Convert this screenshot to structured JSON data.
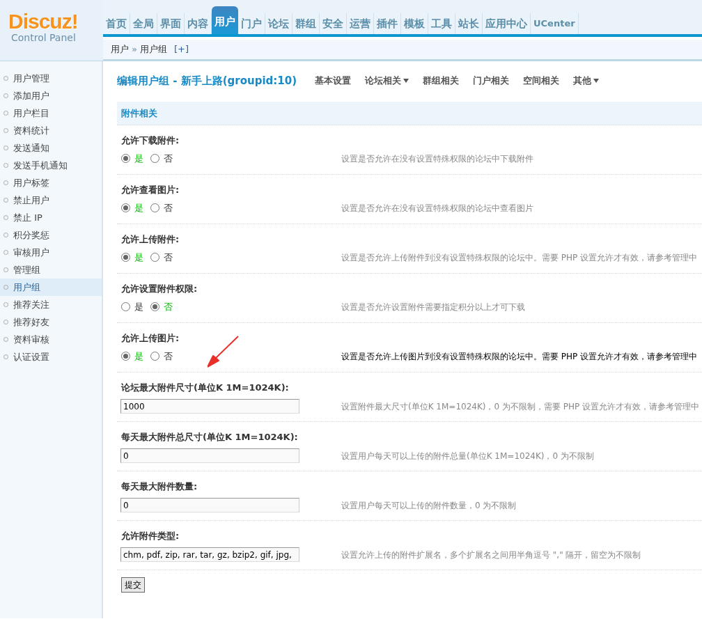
{
  "logo": {
    "title": "Discuz!",
    "subtitle": "Control Panel"
  },
  "nav": [
    {
      "label": "首页",
      "selected": false
    },
    {
      "label": "全局",
      "selected": false
    },
    {
      "label": "界面",
      "selected": false
    },
    {
      "label": "内容",
      "selected": false
    },
    {
      "label": "用户",
      "selected": true
    },
    {
      "label": "门户",
      "selected": false
    },
    {
      "label": "论坛",
      "selected": false
    },
    {
      "label": "群组",
      "selected": false
    },
    {
      "label": "安全",
      "selected": false
    },
    {
      "label": "运营",
      "selected": false
    },
    {
      "label": "插件",
      "selected": false
    },
    {
      "label": "模板",
      "selected": false
    },
    {
      "label": "工具",
      "selected": false
    },
    {
      "label": "站长",
      "selected": false
    },
    {
      "label": "应用中心",
      "selected": false
    },
    {
      "label": "UCenter",
      "selected": false
    }
  ],
  "breadcrumb": {
    "items": [
      "用户",
      "用户组"
    ],
    "separator": "»",
    "add": "[+]"
  },
  "sidebar": {
    "items": [
      {
        "label": "用户管理",
        "selected": false
      },
      {
        "label": "添加用户",
        "selected": false
      },
      {
        "label": "用户栏目",
        "selected": false
      },
      {
        "label": "资料统计",
        "selected": false
      },
      {
        "label": "发送通知",
        "selected": false
      },
      {
        "label": "发送手机通知",
        "selected": false
      },
      {
        "label": "用户标签",
        "selected": false
      },
      {
        "label": "禁止用户",
        "selected": false
      },
      {
        "label": "禁止 IP",
        "selected": false
      },
      {
        "label": "积分奖惩",
        "selected": false
      },
      {
        "label": "审核用户",
        "selected": false
      },
      {
        "label": "管理组",
        "selected": false
      },
      {
        "label": "用户组",
        "selected": true
      },
      {
        "label": "推荐关注",
        "selected": false
      },
      {
        "label": "推荐好友",
        "selected": false
      },
      {
        "label": "资料审核",
        "selected": false
      },
      {
        "label": "认证设置",
        "selected": false
      }
    ]
  },
  "page": {
    "title": "编辑用户组 - 新手上路(groupid:10)",
    "tabs": [
      {
        "label": "基本设置",
        "dropdown": false
      },
      {
        "label": "论坛相关",
        "dropdown": true
      },
      {
        "label": "群组相关",
        "dropdown": false
      },
      {
        "label": "门户相关",
        "dropdown": false
      },
      {
        "label": "空间相关",
        "dropdown": false
      },
      {
        "label": "其他",
        "dropdown": true
      }
    ]
  },
  "section": {
    "title": "附件相关"
  },
  "settings": [
    {
      "kind": "radio",
      "label": "允许下载附件:",
      "options": [
        {
          "label": "是",
          "selected": true
        },
        {
          "label": "否",
          "selected": false
        }
      ],
      "description": "设置是否允许在没有设置特殊权限的论坛中下载附件",
      "highlighted": false
    },
    {
      "kind": "radio",
      "label": "允许查看图片:",
      "options": [
        {
          "label": "是",
          "selected": true
        },
        {
          "label": "否",
          "selected": false
        }
      ],
      "description": "设置是否允许在没有设置特殊权限的论坛中查看图片",
      "highlighted": false
    },
    {
      "kind": "radio",
      "label": "允许上传附件:",
      "options": [
        {
          "label": "是",
          "selected": true
        },
        {
          "label": "否",
          "selected": false
        }
      ],
      "description": "设置是否允许上传附件到没有设置特殊权限的论坛中。需要 PHP 设置允许才有效，请参考管理中",
      "highlighted": false
    },
    {
      "kind": "radio",
      "label": "允许设置附件权限:",
      "options": [
        {
          "label": "是",
          "selected": false
        },
        {
          "label": "否",
          "selected": true
        }
      ],
      "description": "设置是否允许设置附件需要指定积分以上才可下载",
      "highlighted": false
    },
    {
      "kind": "radio",
      "label": "允许上传图片:",
      "options": [
        {
          "label": "是",
          "selected": true
        },
        {
          "label": "否",
          "selected": false
        }
      ],
      "description": "设置是否允许上传图片到没有设置特殊权限的论坛中。需要 PHP 设置允许才有效，请参考管理中",
      "highlighted": true
    },
    {
      "kind": "text",
      "label": "论坛最大附件尺寸(单位K 1M=1024K):",
      "value": "1000",
      "description": "设置附件最大尺寸(单位K 1M=1024K)，0 为不限制，需要 PHP 设置允许才有效，请参考管理中",
      "highlighted": false
    },
    {
      "kind": "text",
      "label": "每天最大附件总尺寸(单位K 1M=1024K):",
      "value": "0",
      "description": "设置用户每天可以上传的附件总量(单位K 1M=1024K)，0 为不限制",
      "highlighted": false
    },
    {
      "kind": "text",
      "label": "每天最大附件数量:",
      "value": "0",
      "description": "设置用户每天可以上传的附件数量，0 为不限制",
      "highlighted": false
    },
    {
      "kind": "text",
      "label": "允许附件类型:",
      "value": "chm, pdf, zip, rar, tar, gz, bzip2, gif, jpg,",
      "description": "设置允许上传的附件扩展名，多个扩展名之间用半角逗号 \",\" 隔开，留空为不限制",
      "highlighted": false
    }
  ],
  "submit": "提交"
}
